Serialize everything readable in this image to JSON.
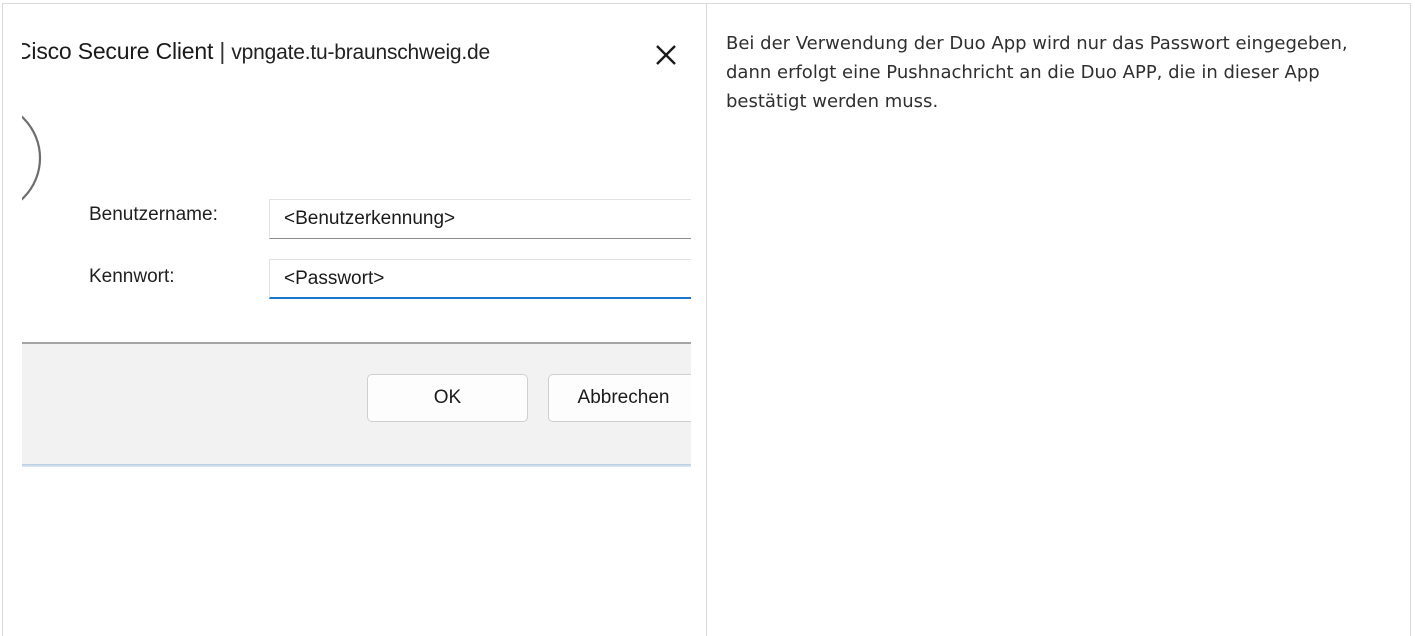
{
  "dialog": {
    "title_app": "Cisco Secure Client",
    "title_separator": "|",
    "title_host": "vpngate.tu-braunschweig.de",
    "close_glyph": "×",
    "username_label": "Benutzername:",
    "username_value": "<Benutzerkennung>",
    "password_label": "Kennwort:",
    "password_value": "<Passwort>",
    "ok_label": "OK",
    "cancel_label": "Abbrechen",
    "accent_color": "#1976c9",
    "logo_icon": "cisco-secure-client-logo-icon"
  },
  "note": {
    "text": "Bei der Verwendung der Duo App wird nur das Passwort eingegeben, dann erfolgt eine Pushnachricht an die Duo APP, die in dieser App bestätigt werden muss."
  }
}
